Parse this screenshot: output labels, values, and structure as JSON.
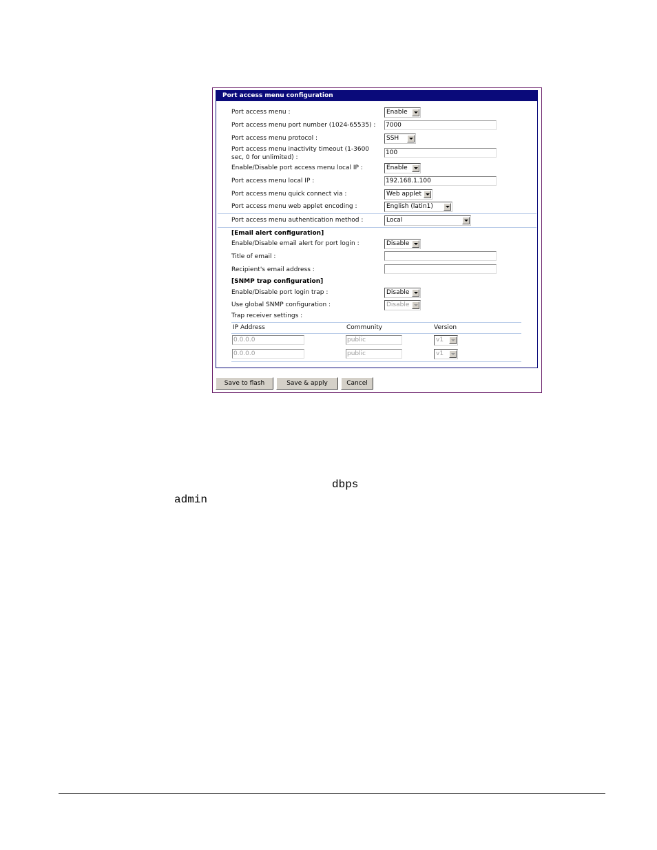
{
  "panel": {
    "title": "Port access menu configuration",
    "rows": [
      {
        "label": "Port access menu :",
        "value": "Enable"
      },
      {
        "label": "Port access menu port number (1024-65535) :",
        "value": "7000"
      },
      {
        "label": "Port access menu protocol :",
        "value": "SSH"
      },
      {
        "label": "Port access menu inactivity timeout (1-3600",
        "label2": "sec, 0 for unlimited) :",
        "value": "100"
      },
      {
        "label": "Enable/Disable port access menu local IP :",
        "value": "Enable"
      },
      {
        "label": "Port access menu local IP :",
        "value": "192.168.1.100"
      },
      {
        "label": "Port access menu quick connect via :",
        "value": "Web applet"
      },
      {
        "label": "Port access menu web applet encoding :",
        "value": "English (latin1)"
      },
      {
        "label": "Port access menu authentication method :",
        "value": "Local"
      }
    ],
    "email": {
      "heading": "[Email alert configuration]",
      "rows": [
        {
          "label": "Enable/Disable email alert for port login :",
          "value": "Disable"
        },
        {
          "label": "Title of email :",
          "value": ""
        },
        {
          "label": "Recipient's email address :",
          "value": ""
        }
      ]
    },
    "snmp": {
      "heading": "[SNMP trap configuration]",
      "rows": [
        {
          "label": "Enable/Disable port login trap :",
          "value": "Disable"
        },
        {
          "label": "Use global SNMP configuration :",
          "value": "Disable"
        }
      ],
      "trap_label": "Trap receiver settings :",
      "columns": [
        "IP Address",
        "Community",
        "Version"
      ],
      "receivers": [
        {
          "ip": "0.0.0.0",
          "community": "public",
          "version": "v1"
        },
        {
          "ip": "0.0.0.0",
          "community": "public",
          "version": "v1"
        }
      ]
    }
  },
  "buttons": {
    "save_flash": "Save to flash",
    "save_apply": "Save & apply",
    "cancel": "Cancel"
  },
  "body_text": {
    "word1": "dbps",
    "word2": "admin"
  }
}
